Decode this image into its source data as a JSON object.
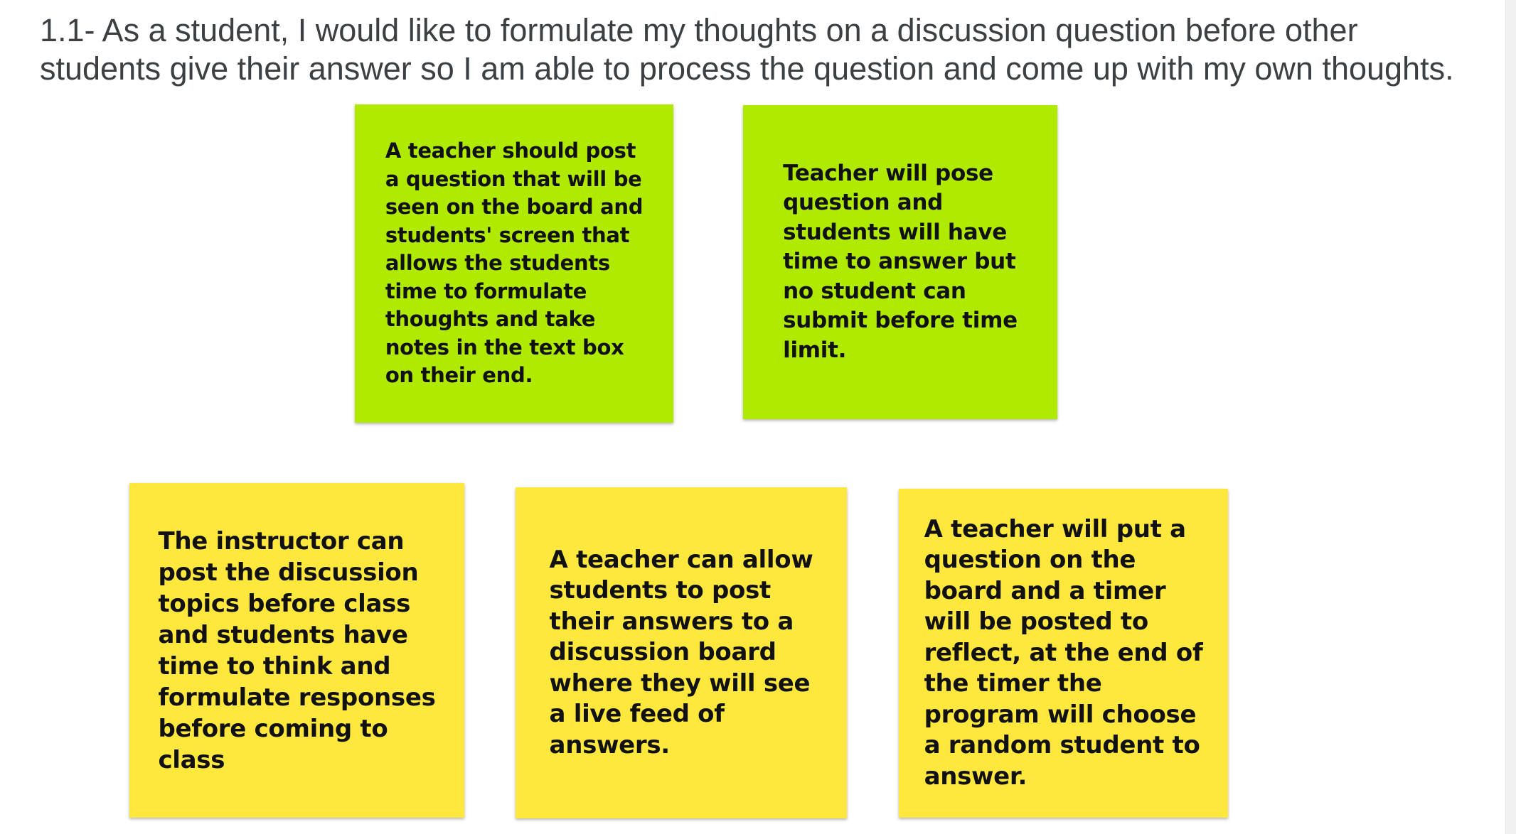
{
  "heading": {
    "text": "1.1- As a student, I would like to formulate my thoughts on a discussion question before other\nstudents give their answer so I am able to process the question and come up with my own thoughts."
  },
  "colors": {
    "green_note": "#b0ea00",
    "yellow_note": "#ffe83d",
    "heading_text": "#3c4043"
  },
  "notes": [
    {
      "color": "green",
      "text": "A teacher should post\na question that will be\nseen on the board and\nstudents' screen that\nallows the students\ntime to formulate\nthoughts and take\nnotes in the text box\non their end."
    },
    {
      "color": "green",
      "text": "Teacher will pose\nquestion and\nstudents will have\ntime to answer but\nno student can\nsubmit before time\nlimit."
    },
    {
      "color": "yellow",
      "text": "The instructor can\npost the discussion\ntopics before class\nand students have\ntime to think and\nformulate responses\nbefore coming to\nclass"
    },
    {
      "color": "yellow",
      "text": "A teacher can allow\nstudents to post\ntheir answers to a\ndiscussion board\nwhere they will see\na live feed of\nanswers."
    },
    {
      "color": "yellow",
      "text": "A teacher will put a\nquestion on the\nboard and a timer\nwill be posted to\nreflect, at the end of\nthe timer the\nprogram will choose\na random student to\nanswer."
    }
  ]
}
